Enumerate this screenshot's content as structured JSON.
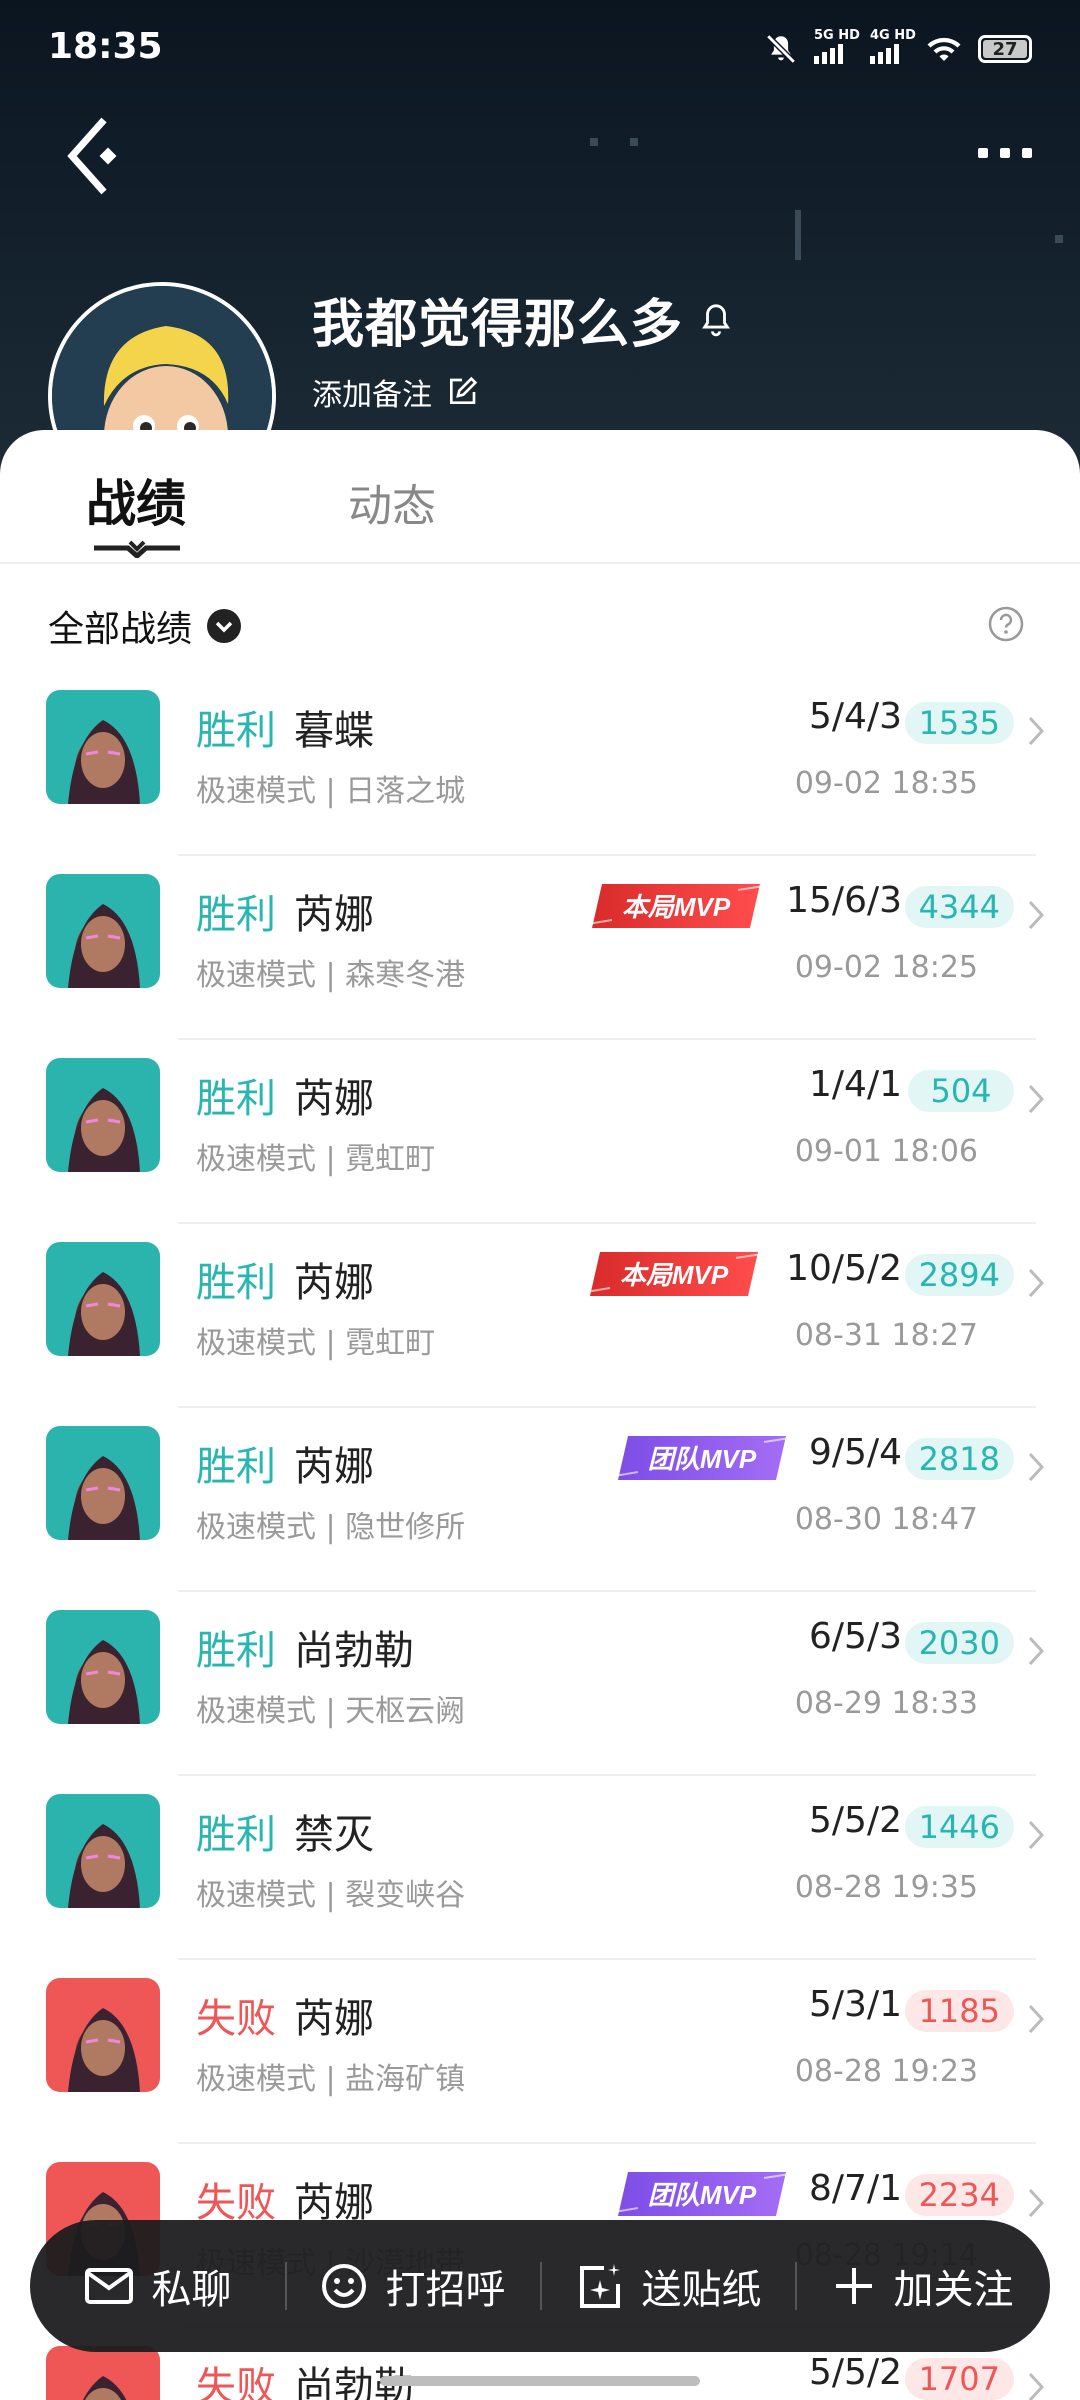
{
  "status_bar": {
    "time": "18:35",
    "sim1": "5G HD",
    "sim2": "4G HD",
    "battery": "27"
  },
  "profile": {
    "nickname": "我都觉得那么多",
    "remark_label": "添加备注"
  },
  "tabs": [
    {
      "label": "战绩",
      "active": true
    },
    {
      "label": "动态",
      "active": false
    }
  ],
  "filter": {
    "label": "全部战绩"
  },
  "matches": [
    {
      "result": "胜利",
      "outcome": "win",
      "hero": "暮蝶",
      "mode": "极速模式 | 日落之城",
      "kda": "5/4/3",
      "score": "1535",
      "date": "09-02 18:35",
      "mvp": "",
      "hero_color": "#2bb3ad"
    },
    {
      "result": "胜利",
      "outcome": "win",
      "hero": "芮娜",
      "mode": "极速模式 | 森寒冬港",
      "kda": "15/6/3",
      "score": "4344",
      "date": "09-02 18:25",
      "mvp": "本局MVP",
      "mvp_type": "match",
      "hero_color": "#2bb3ad"
    },
    {
      "result": "胜利",
      "outcome": "win",
      "hero": "芮娜",
      "mode": "极速模式 | 霓虹町",
      "kda": "1/4/1",
      "score": "504",
      "date": "09-01 18:06",
      "mvp": "",
      "hero_color": "#2bb3ad"
    },
    {
      "result": "胜利",
      "outcome": "win",
      "hero": "芮娜",
      "mode": "极速模式 | 霓虹町",
      "kda": "10/5/2",
      "score": "2894",
      "date": "08-31 18:27",
      "mvp": "本局MVP",
      "mvp_type": "match",
      "hero_color": "#2bb3ad"
    },
    {
      "result": "胜利",
      "outcome": "win",
      "hero": "芮娜",
      "mode": "极速模式 | 隐世修所",
      "kda": "9/5/4",
      "score": "2818",
      "date": "08-30 18:47",
      "mvp": "团队MVP",
      "mvp_type": "team",
      "hero_color": "#2bb3ad"
    },
    {
      "result": "胜利",
      "outcome": "win",
      "hero": "尚勃勒",
      "mode": "极速模式 | 天枢云阙",
      "kda": "6/5/3",
      "score": "2030",
      "date": "08-29 18:33",
      "mvp": "",
      "hero_color": "#2bb3ad"
    },
    {
      "result": "胜利",
      "outcome": "win",
      "hero": "禁灭",
      "mode": "极速模式 | 裂变峡谷",
      "kda": "5/5/2",
      "score": "1446",
      "date": "08-28 19:35",
      "mvp": "",
      "hero_color": "#2bb3ad"
    },
    {
      "result": "失败",
      "outcome": "loss",
      "hero": "芮娜",
      "mode": "极速模式 | 盐海矿镇",
      "kda": "5/3/1",
      "score": "1185",
      "date": "08-28 19:23",
      "mvp": "",
      "hero_color": "#ef5656"
    },
    {
      "result": "失败",
      "outcome": "loss",
      "hero": "芮娜",
      "mode": "极速模式 | 沙漠地带",
      "kda": "8/7/1",
      "score": "2234",
      "date": "08-28 19:14",
      "mvp": "团队MVP",
      "mvp_type": "team",
      "hero_color": "#ef5656"
    },
    {
      "result": "失败",
      "outcome": "loss",
      "hero": "尚勃勒",
      "mode": "",
      "kda": "5/5/2",
      "score": "1707",
      "date": "",
      "mvp": "",
      "hero_color": "#ef5656"
    }
  ],
  "bottom_bar": [
    {
      "label": "私聊",
      "icon": "mail-icon"
    },
    {
      "label": "打招呼",
      "icon": "smile-icon"
    },
    {
      "label": "送贴纸",
      "icon": "sticker-icon"
    },
    {
      "label": "加关注",
      "icon": "plus-icon"
    }
  ]
}
